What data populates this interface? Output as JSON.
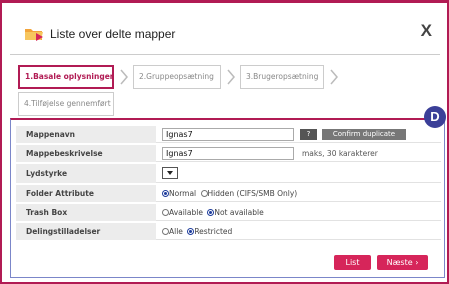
{
  "dialog": {
    "title": "Liste over delte mapper",
    "close_label": "X"
  },
  "steps": [
    {
      "label": "1.Basale oplysninger",
      "active": true
    },
    {
      "label": "2.Gruppeopsætning",
      "active": false
    },
    {
      "label": "3.Brugeropsætning",
      "active": false
    },
    {
      "label": "4.Tilføjelse gennemført",
      "active": false
    }
  ],
  "badge": "D",
  "form": {
    "share_name": {
      "label": "Mappenavn",
      "value": "Ignas7",
      "q_label": "?",
      "confirm_label": "Confirm duplicate"
    },
    "description": {
      "label": "Mappebeskrivelse",
      "value": "Ignas7",
      "hint": "maks, 30 karakterer"
    },
    "volume": {
      "label": "Lydstyrke"
    },
    "folder_attribute": {
      "label": "Folder Attribute",
      "options": [
        "Normal",
        "Hidden (CIFS/SMB Only)"
      ],
      "selected": "Normal"
    },
    "trash_box": {
      "label": "Trash Box",
      "options": [
        "Available",
        "Not available"
      ],
      "selected": "Not available"
    },
    "share_permissions": {
      "label": "Delingstilladelser",
      "options": [
        "Alle",
        "Restricted"
      ],
      "selected": "Restricted"
    }
  },
  "buttons": {
    "list": "List",
    "next": "Næste ›"
  },
  "colors": {
    "accent": "#b11b54",
    "button": "#d6255a",
    "badge": "#3b3f98"
  }
}
